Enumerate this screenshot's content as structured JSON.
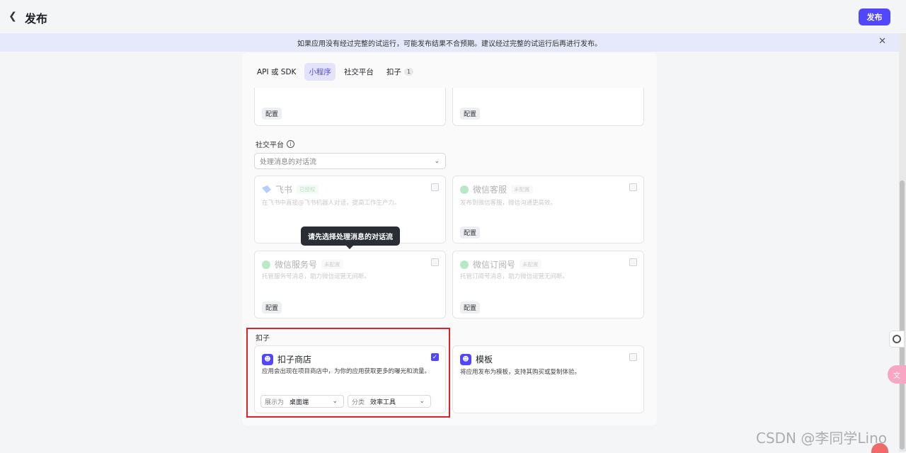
{
  "header": {
    "back_icon": "chevron-left-icon",
    "title": "发布",
    "publish_label": "发布"
  },
  "banner": {
    "text": "如果应用没有经过完整的试运行，可能发布结果不合预期。建议经过完整的试运行后再进行发布。",
    "close_icon": "close-icon"
  },
  "tabs": [
    {
      "label": "API 或 SDK",
      "active": false
    },
    {
      "label": "小程序",
      "active": true
    },
    {
      "label": "社交平台",
      "active": false
    },
    {
      "label": "扣子",
      "active": false,
      "badge": "1"
    }
  ],
  "top_cards": [
    {
      "config_label": "配置"
    },
    {
      "config_label": "配置"
    }
  ],
  "social": {
    "section_label": "社交平台",
    "select_placeholder": "处理消息的对话流",
    "cards": [
      {
        "name": "飞书",
        "status": "已授权",
        "desc": "在飞书中直接@飞书机器人对话，提高工作生产力。",
        "icon": "feishu-icon"
      },
      {
        "name": "微信客服",
        "status": "未配置",
        "desc": "发布到微信客服，微信沟通更高效。",
        "config_label": "配置",
        "icon": "wechat-icon"
      },
      {
        "name": "微信服务号",
        "status": "未配置",
        "desc": "托管服务号消息，助力微信运营无间断。",
        "config_label": "配置",
        "icon": "wechat-icon"
      },
      {
        "name": "微信订阅号",
        "status": "未配置",
        "desc": "托管订阅号消息，助力微信运营无间断。",
        "config_label": "配置",
        "icon": "wechat-icon"
      }
    ],
    "tooltip": "请先选择处理消息的对话流"
  },
  "coze": {
    "section_label": "扣子",
    "store": {
      "name": "扣子商店",
      "desc": "应用会出现在项目商店中，为你的应用获取更多的曝光和流量。",
      "checked": true,
      "display_label": "展示为",
      "display_value": "桌面端",
      "category_label": "分类",
      "category_value": "效率工具"
    },
    "template": {
      "name": "模板",
      "desc": "将应用发布为模板，支持其购买或复制体验。",
      "checked": false
    }
  },
  "watermark": "CSDN @李同学Lino",
  "colors": {
    "accent": "#5147ff",
    "highlight": "#e0202a"
  }
}
